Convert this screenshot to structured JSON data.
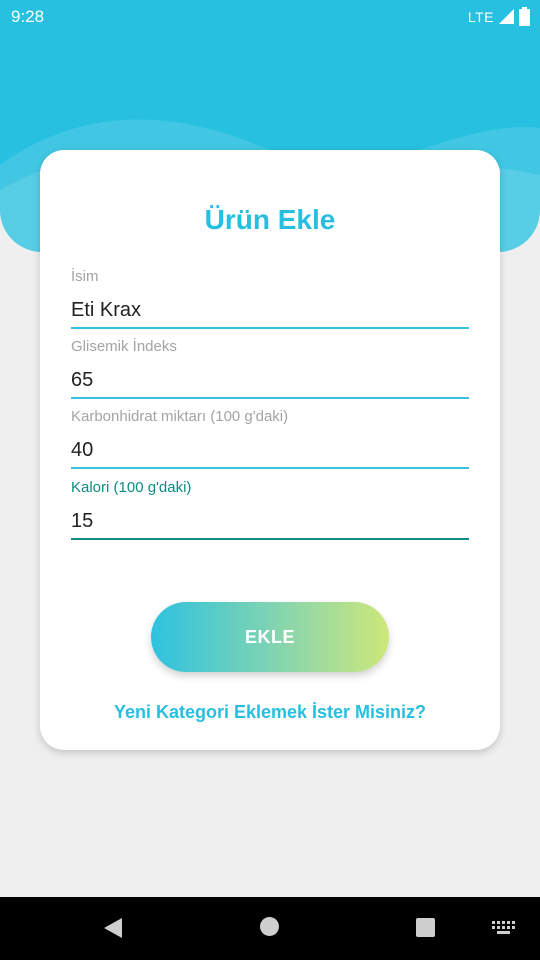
{
  "status_bar": {
    "time": "9:28",
    "network": "LTE"
  },
  "form": {
    "title": "Ürün Ekle",
    "fields": [
      {
        "label": "İsim",
        "value": "Eti Krax"
      },
      {
        "label": "Glisemik İndeks",
        "value": "65"
      },
      {
        "label": "Karbonhidrat miktarı (100 g'daki)",
        "value": "40"
      },
      {
        "label": "Kalori (100 g'daki)",
        "value": "15"
      }
    ],
    "submit_label": "EKLE",
    "category_link": "Yeni Kategori Eklemek İster Misiniz?"
  },
  "colors": {
    "primary": "#27c0e0",
    "active_field": "#0f8a85",
    "gradient_start": "#2ec2e0",
    "gradient_end": "#cee77a",
    "background": "#efefef"
  },
  "icons": [
    "signal-icon",
    "battery-icon",
    "back-icon",
    "home-icon",
    "recent-apps-icon",
    "keyboard-icon"
  ]
}
